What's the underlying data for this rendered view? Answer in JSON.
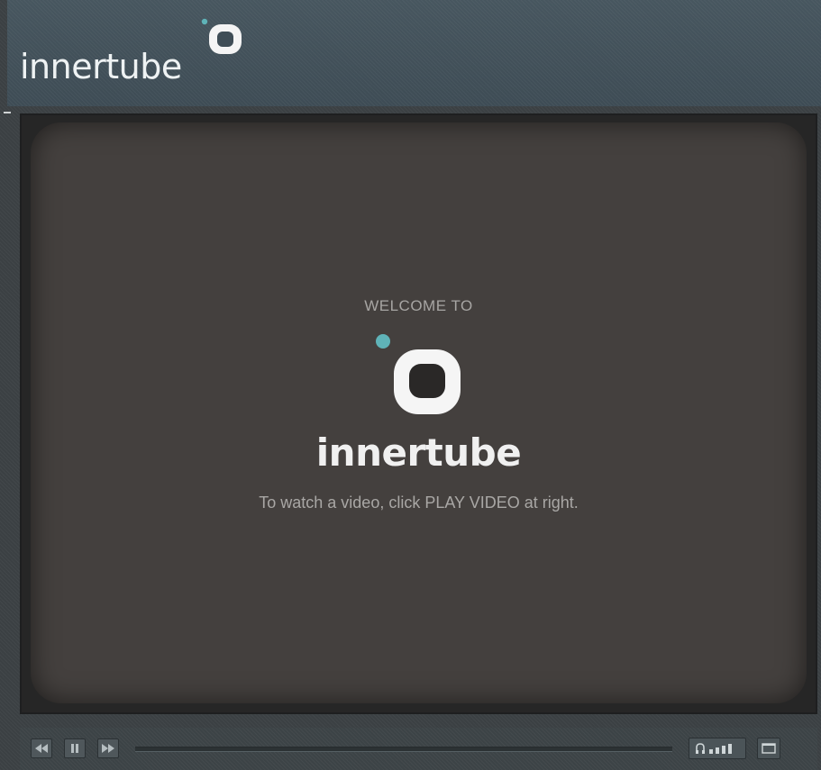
{
  "header": {
    "logo_text": "innertube"
  },
  "player": {
    "welcome_label": "WELCOME TO",
    "brand_name": "innertube",
    "instructions": "To watch a video, click PLAY VIDEO at right.",
    "progress_fraction": 0,
    "volume_level_bars": 4
  },
  "controls": {
    "rewind_icon": "rewind-icon",
    "pause_icon": "pause-icon",
    "fast_forward_icon": "fast-forward-icon",
    "volume_icon": "volume-icon",
    "fullscreen_icon": "fullscreen-icon"
  },
  "colors": {
    "accent": "#5fb3b8",
    "logo_white": "#f4f4f4",
    "header_bg": "#445259",
    "screen_bg": "#44403e"
  }
}
